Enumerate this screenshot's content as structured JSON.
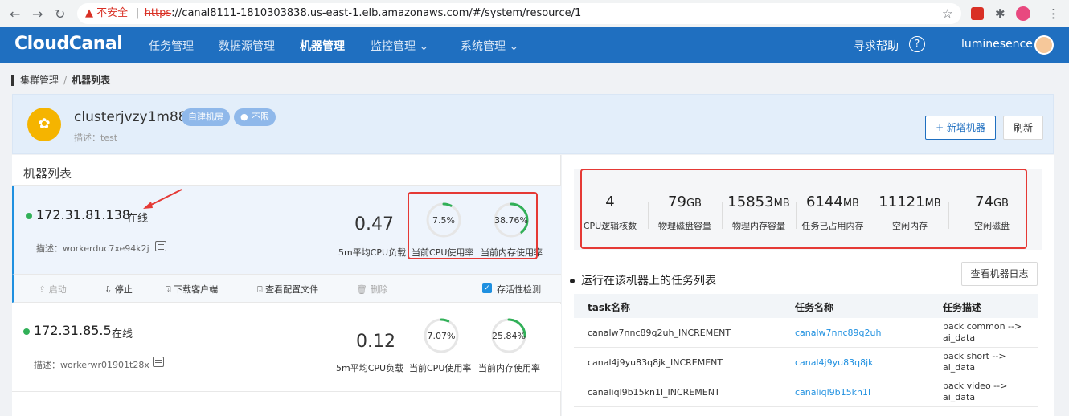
{
  "browser": {
    "insecure_label": "不安全",
    "url_scheme": "https",
    "url_rest": "://canal8111-1810303838.us-east-1.elb.amazonaws.com/#/system/resource/1"
  },
  "app": {
    "logo": "CloudCanal",
    "nav": [
      "任务管理",
      "数据源管理",
      "机器管理",
      "监控管理 ⌄",
      "系统管理 ⌄"
    ],
    "help": "寻求帮助",
    "user": "luminesence"
  },
  "breadcrumb": {
    "parent": "集群管理",
    "current": "机器列表"
  },
  "cluster": {
    "name": "clusterjvzy1m88c2",
    "tags": [
      "自建机房",
      "不限"
    ],
    "desc": "描述：test",
    "add_label": "+ 新增机器",
    "refresh_label": "刷新"
  },
  "machines": {
    "title": "机器列表",
    "items": [
      {
        "ip": "172.31.81.138",
        "status": "在线",
        "desc": "描述：workerduc7xe94k2j",
        "load": "0.47",
        "load_label": "5m平均CPU负载",
        "cpu": "7.5%",
        "cpu_label": "当前CPU使用率",
        "mem": "38.76%",
        "mem_label": "当前内存使用率"
      },
      {
        "ip": "172.31.85.5",
        "status": "在线",
        "desc": "描述：workerwr01901t28x",
        "load": "0.12",
        "load_label": "5m平均CPU负载",
        "cpu": "7.07%",
        "cpu_label": "当前CPU使用率",
        "mem": "25.84%",
        "mem_label": "当前内存使用率"
      }
    ],
    "gauge_values": [
      [
        7.5,
        38.76
      ],
      [
        7.07,
        25.84
      ]
    ],
    "actions": {
      "start": "启动",
      "stop": "停止",
      "download": "下载客户端",
      "config": "查看配置文件",
      "delete": "删除",
      "liveness": "存活性检测"
    }
  },
  "stats": [
    {
      "value": "4",
      "unit": "",
      "label": "CPU逻辑核数"
    },
    {
      "value": "79",
      "unit": "GB",
      "label": "物理磁盘容量"
    },
    {
      "value": "15853",
      "unit": "MB",
      "label": "物理内存容量"
    },
    {
      "value": "6144",
      "unit": "MB",
      "label": "任务已占用内存"
    },
    {
      "value": "11121",
      "unit": "MB",
      "label": "空闲内存"
    },
    {
      "value": "74",
      "unit": "GB",
      "label": "空闲磁盘"
    }
  ],
  "tasks": {
    "title": "运行在该机器上的任务列表",
    "log_button": "查看机器日志",
    "headers": [
      "task名称",
      "任务名称",
      "任务描述"
    ],
    "rows": [
      [
        "canalw7nnc89q2uh_INCREMENT",
        "canalw7nnc89q2uh",
        "back common --> ai_data"
      ],
      [
        "canal4j9yu83q8jk_INCREMENT",
        "canal4j9yu83q8jk",
        "back short --> ai_data"
      ],
      [
        "canaliql9b15kn1l_INCREMENT",
        "canaliql9b15kn1l",
        "back video --> ai_data"
      ]
    ]
  },
  "colors": {
    "brand": "#1f6fc0",
    "online": "#31b058",
    "highlight": "#e53935",
    "gauge": "#31b058"
  }
}
